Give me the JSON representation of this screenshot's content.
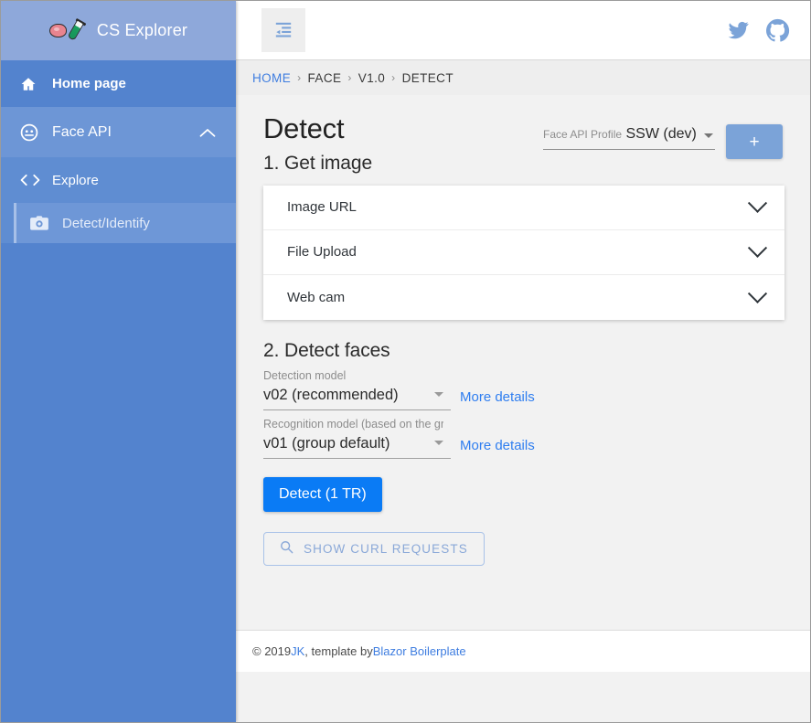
{
  "brand": {
    "title": "CS Explorer",
    "logo_icons": [
      "brain-icon",
      "test-tube-icon"
    ]
  },
  "sidebar": {
    "items": [
      {
        "label": "Home page",
        "icon": "home-icon",
        "state": "normal"
      },
      {
        "label": "Face API",
        "icon": "face-icon",
        "state": "expanded",
        "chevron": "chevron-up-icon"
      },
      {
        "label": "Explore",
        "icon": "code-brackets-icon",
        "state": "normal"
      },
      {
        "label": "Detect/Identify",
        "icon": "camera-icon",
        "state": "active"
      }
    ],
    "colors": {
      "background": "#5383ce",
      "brand_background": "#8ea8da",
      "active_accent": "#a7c0e8"
    }
  },
  "topbar": {
    "toggle_icon": "format-indent-decrease-icon",
    "social": [
      {
        "icon": "twitter-icon"
      },
      {
        "icon": "github-icon"
      }
    ]
  },
  "breadcrumb": {
    "items": [
      {
        "label": "HOME",
        "link": true
      },
      {
        "label": "FACE",
        "link": false
      },
      {
        "label": "V1.0",
        "link": false
      },
      {
        "label": "DETECT",
        "link": false
      }
    ],
    "separator": "›"
  },
  "main": {
    "page_title": "Detect",
    "profile_select": {
      "label": "Face API Profile",
      "value": "SSW (dev)",
      "arrow_icon": "caret-down-icon"
    },
    "add_profile_button": {
      "label": "+",
      "color": "#7ba3d8"
    },
    "section_get_image": {
      "title": "1. Get image",
      "panels": [
        {
          "title": "Image URL",
          "icon": "chevron-down-icon"
        },
        {
          "title": "File Upload",
          "icon": "chevron-down-icon"
        },
        {
          "title": "Web cam",
          "icon": "chevron-down-icon"
        }
      ]
    },
    "section_detect_faces": {
      "title": "2. Detect faces",
      "detection_model": {
        "label": "Detection model",
        "value": "v02 (recommended)",
        "more_details": "More details"
      },
      "recognition_model": {
        "label": "Recognition model (based on the gr",
        "value": "v01 (group default)",
        "more_details": "More details"
      },
      "detect_button": {
        "label": "Detect (1 TR)",
        "color": "#0a7bf5"
      },
      "curl_button": {
        "label": "SHOW CURL REQUESTS",
        "icon": "search-icon"
      }
    }
  },
  "footer": {
    "copyright": "© 2019 ",
    "author": "JK",
    "middle": ", template by ",
    "template": "Blazor Boilerplate"
  }
}
